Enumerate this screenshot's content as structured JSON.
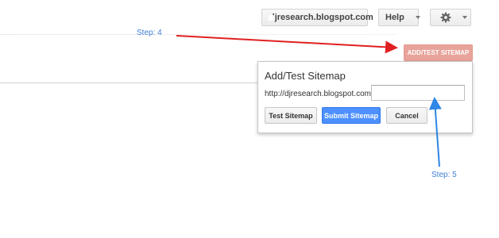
{
  "header": {
    "site_selector": {
      "label": "djresearch.blogspot.com",
      "icon": "blogger-icon"
    },
    "help_label": "Help",
    "settings_icon": "gear-icon"
  },
  "annotations": {
    "step4": "Step: 4",
    "step5": "Step: 5",
    "step4_color": "#e02020",
    "step5_color": "#2e86e6"
  },
  "add_sitemap_button": {
    "label": "ADD/TEST SITEMAP",
    "color": "#e8a39a"
  },
  "dialog": {
    "title": "Add/Test Sitemap",
    "url_prefix": "http://djresearch.blogspot.com/",
    "input": {
      "value": "",
      "placeholder": ""
    },
    "buttons": {
      "test": "Test Sitemap",
      "submit": "Submit Sitemap",
      "cancel": "Cancel"
    },
    "submit_color": "#4d90fe"
  }
}
